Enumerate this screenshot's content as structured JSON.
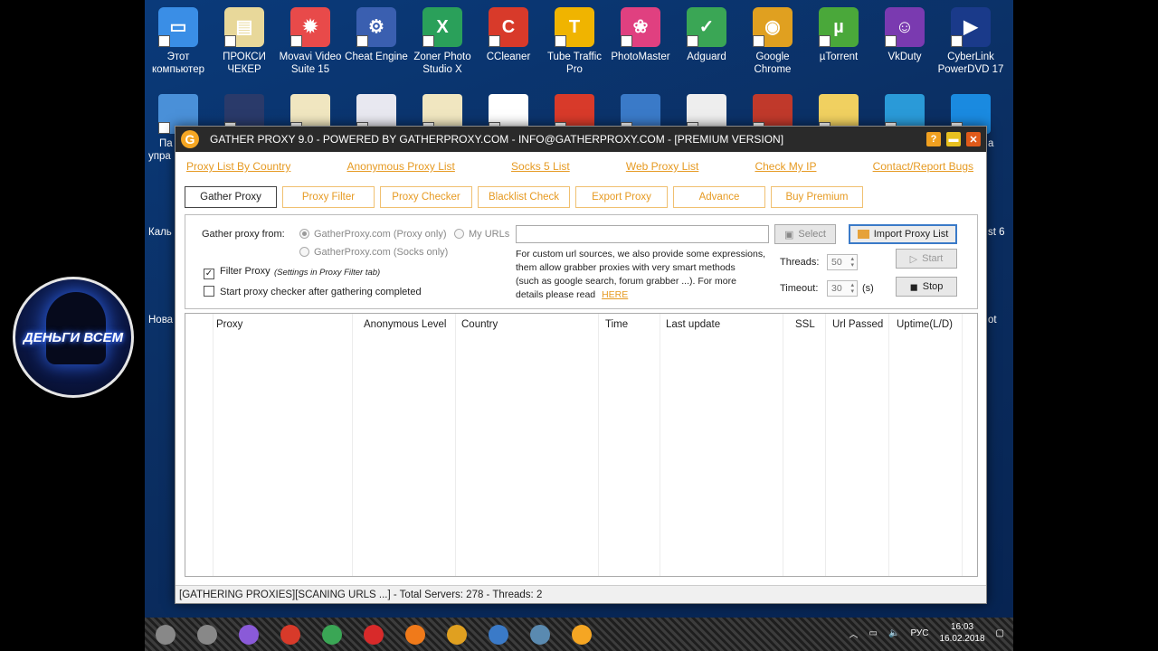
{
  "desktop": {
    "icons_row1": [
      {
        "label": "Этот\nкомпьютер",
        "color": "#3a8ee6",
        "glyph": "▭"
      },
      {
        "label": "ПРОКСИ\nЧЕКЕР",
        "color": "#e8d89a",
        "glyph": "▤"
      },
      {
        "label": "Movavi Video\nSuite 15",
        "color": "#e84a4a",
        "glyph": "✹"
      },
      {
        "label": "Cheat Engine",
        "color": "#3a5fb0",
        "glyph": "⚙"
      },
      {
        "label": "Zoner Photo\nStudio X",
        "color": "#2aa05a",
        "glyph": "X"
      },
      {
        "label": "CCleaner",
        "color": "#d83a2a",
        "glyph": "C"
      },
      {
        "label": "Tube Traffic\nPro",
        "color": "#f0b400",
        "glyph": "T"
      },
      {
        "label": "PhotoMaster",
        "color": "#e04080",
        "glyph": "❀"
      },
      {
        "label": "Adguard",
        "color": "#3aa655",
        "glyph": "✓"
      },
      {
        "label": "Google\nChrome",
        "color": "#e0a020",
        "glyph": "◉"
      },
      {
        "label": "µTorrent",
        "color": "#4aa83a",
        "glyph": "µ"
      },
      {
        "label": "VkDuty",
        "color": "#7a3ab0",
        "glyph": "☺"
      },
      {
        "label": "CyberLink\nPowerDVD 17",
        "color": "#1a3a8a",
        "glyph": "▶"
      }
    ],
    "icons_row2": [
      "#4a90d8",
      "#2a3a6a",
      "#f0e6c0",
      "#e8e8f0",
      "#f0e6c0",
      "#ffffff",
      "#d83a2a",
      "#3a7ac8",
      "#eeeeee",
      "#c0392b",
      "#f0d060",
      "#2a9ad8",
      "#1a8ae0"
    ],
    "side_labels": {
      "left1": "Па",
      "left1b": "упра",
      "left2": "Каль",
      "left3": "Нова",
      "right1": "а",
      "right2": "st 6",
      "right3": "ot"
    },
    "avatar_text": "ДЕНЬГИ ВСЕМ"
  },
  "window": {
    "title": "GATHER PROXY 9.0 - POWERED BY GATHERPROXY.COM - INFO@GATHERPROXY.COM - [PREMIUM VERSION]",
    "app_icon": "G",
    "title_buttons": {
      "help": "?",
      "minimize": "▬",
      "close": "✕"
    },
    "links": [
      "Proxy List By Country",
      "Anonymous Proxy List",
      "Socks 5 List",
      "Web Proxy List",
      "Check My IP",
      "Contact/Report Bugs"
    ],
    "tabs": [
      {
        "label": "Gather Proxy",
        "active": true
      },
      {
        "label": "Proxy Filter"
      },
      {
        "label": "Proxy Checker"
      },
      {
        "label": "Blacklist Check"
      },
      {
        "label": "Export Proxy"
      },
      {
        "label": "Advance"
      },
      {
        "label": "Buy Premium"
      }
    ],
    "gather": {
      "from_label": "Gather proxy from:",
      "opt_http": "GatherProxy.com (Proxy only)",
      "opt_socks": "GatherProxy.com (Socks only)",
      "opt_urls": "My URLs",
      "url_value": "",
      "select_btn": "Select",
      "import_btn": "Import Proxy List",
      "filter_label": "Filter Proxy",
      "filter_note": "(Settings in Proxy Filter tab)",
      "filter_checked": true,
      "start_checker_label": "Start proxy checker after gathering completed",
      "help_line1": "For custom url sources, we also provide some expressions,",
      "help_line2": "them allow grabber proxies with very smart methods",
      "help_line3": "(such as google search, forum grabber ...). For more",
      "help_line4": "details please read",
      "help_link": "HERE",
      "threads_label": "Threads:",
      "threads_value": "50",
      "timeout_label": "Timeout:",
      "timeout_value": "30",
      "timeout_unit": "(s)",
      "start_btn": "Start",
      "stop_btn": "Stop"
    },
    "grid_headers": [
      "Proxy",
      "Anonymous Level",
      "Country",
      "Time",
      "Last update",
      "SSL",
      "Url Passed",
      "Uptime(L/D)"
    ],
    "status": "[GATHERING PROXIES][SCANING URLS ...] - Total Servers: 278 - Threads: 2"
  },
  "taskbar": {
    "icons": [
      "#888888",
      "#888888",
      "#8a5ad8",
      "#d83a2a",
      "#3aa655",
      "#d82a2a",
      "#f07a1a",
      "#e0a020",
      "#3a7ac8",
      "#5a8ab0",
      "#f5a623"
    ],
    "lang": "РУС",
    "time": "16:03",
    "date": "16.02.2018"
  }
}
